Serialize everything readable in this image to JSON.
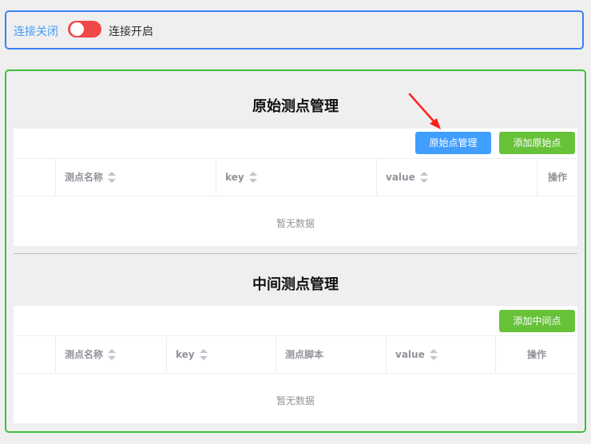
{
  "connection": {
    "off_label": "连接关闭",
    "on_label": "连接开启",
    "toggle_color": "#f04848"
  },
  "original_points": {
    "title": "原始测点管理",
    "buttons": {
      "manage": "原始点管理",
      "add": "添加原始点"
    },
    "columns": [
      "",
      "测点名称",
      "key",
      "value",
      "操作"
    ],
    "empty_text": "暂无数据"
  },
  "middle_points": {
    "title": "中间测点管理",
    "buttons": {
      "add": "添加中间点"
    },
    "columns": [
      "",
      "测点名称",
      "key",
      "测点脚本",
      "value",
      "操作"
    ],
    "empty_text": "暂无数据"
  }
}
